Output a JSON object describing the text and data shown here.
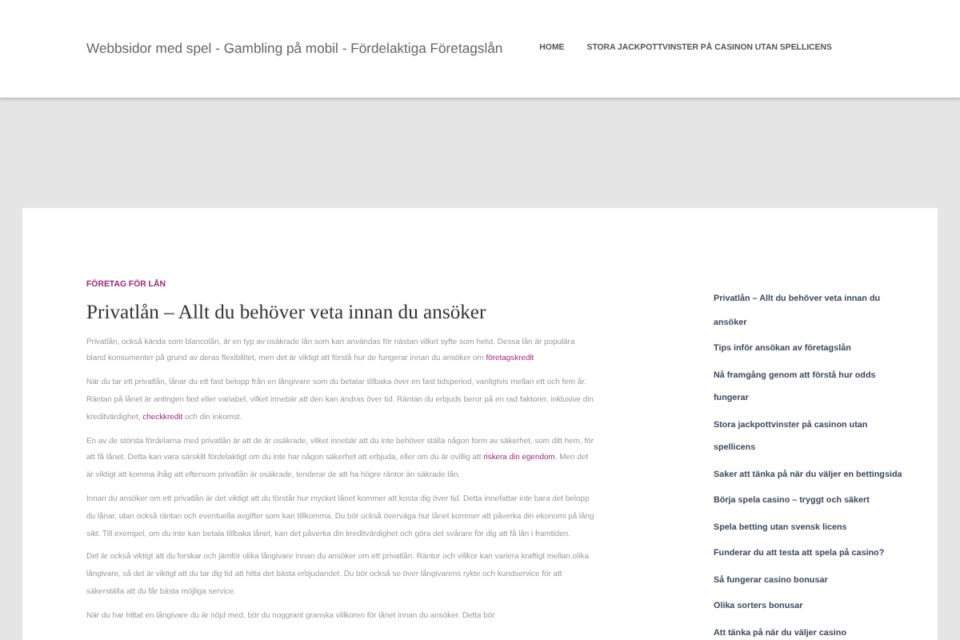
{
  "site_title": "Webbsidor med spel - Gambling på mobil - Fördelaktiga Företagslån",
  "nav": [
    {
      "label": "HOME",
      "selected": false
    },
    {
      "label": "STORA JACKPOTTVINSTER PÅ CASINON UTAN SPELLICENS",
      "selected": false
    }
  ],
  "article": {
    "category": "FÖRETAG FÖR LÅN",
    "title": "Privatlån – Allt du behöver veta innan du ansöker",
    "paragraphs": [
      [
        {
          "text": "Privatlån, också kända som blancolån, är en typ av osäkrade lån som kan användas för nästan vilket syfte som helst. Dessa lån är populära bland konsumenter på grund av deras flexibilitet, men det är viktigt att förstå hur de fungerar innan du ansöker om "
        },
        {
          "text": "företagskredit",
          "link": true
        }
      ],
      [
        {
          "text": "När du tar ett privatlån, lånar du ett fast belopp från en långivare som du betalar tillbaka över en fast tidsperiod, vanligtvis mellan ett och fem år. Räntan på lånet är antingen fast eller variabel, vilket innebär att den kan ändras över tid. Räntan du erbjuds beror på en rad faktorer, inklusive din kreditvärdighet, "
        },
        {
          "text": "checkkredit",
          "link": true
        },
        {
          "text": " och din inkomst."
        }
      ],
      [
        {
          "text": "En av de största fördelarna med privatlån är att de är osäkrade, vilket innebär att du inte behöver ställa någon form av säkerhet, som ditt hem, för att få lånet. Detta kan vara särskilt fördelaktigt om du inte har någon säkerhet att erbjuda, eller om du är ovillig att "
        },
        {
          "text": "riskera din egendom",
          "link": true
        },
        {
          "text": ". Men det är viktigt att komma ihåg att eftersom privatlån är osäkrade, tenderar de att ha högre räntor än säkrade lån."
        }
      ],
      [
        {
          "text": "Innan du ansöker om ett privatlån är det viktigt att du förstår hur mycket lånet kommer att kosta dig över tid. Detta innefattar inte bara det belopp du lånar, utan också räntan och eventuella avgifter som kan tillkomma. Du bör också överväga hur lånet kommer att påverka din ekonomi på lång sikt. Till exempel, om du inte kan betala tillbaka lånet, kan det påverka din kreditvärdighet och göra det svårare för dig att få lån i framtiden."
        }
      ],
      [
        {
          "text": "Det är också viktigt att du forskar och jämför olika långivare innan du ansöker om ett privatlån. Räntor och villkor kan variera kraftigt mellan olika långivare, så det är viktigt att du tar dig tid att hitta det bästa erbjudandet. Du bör också se över långivarens rykte och kundservice för att säkerställa att du får bästa möjliga service."
        }
      ],
      [
        {
          "text": "När du har hittat en långivare du är nöjd med, bör du noggrant granska villkoren för lånet innan du ansöker. Detta bör"
        }
      ]
    ]
  },
  "sidebar": [
    "Privatlån – Allt du behöver veta innan du ansöker",
    "Tips inför ansökan av företagslån",
    "Nå framgång genom att förstå hur odds fungerar",
    "Stora jackpottvinster på casinon utan spellicens",
    "Saker att tänka på när du väljer en bettingsida",
    "Börja spela casino – tryggt och säkert",
    "Spela betting utan svensk licens",
    "Funderar du att testa att spela på casino?",
    "Så fungerar casino bonusar",
    "Olika sorters bonusar",
    "Att tänka på när du väljer casino"
  ]
}
